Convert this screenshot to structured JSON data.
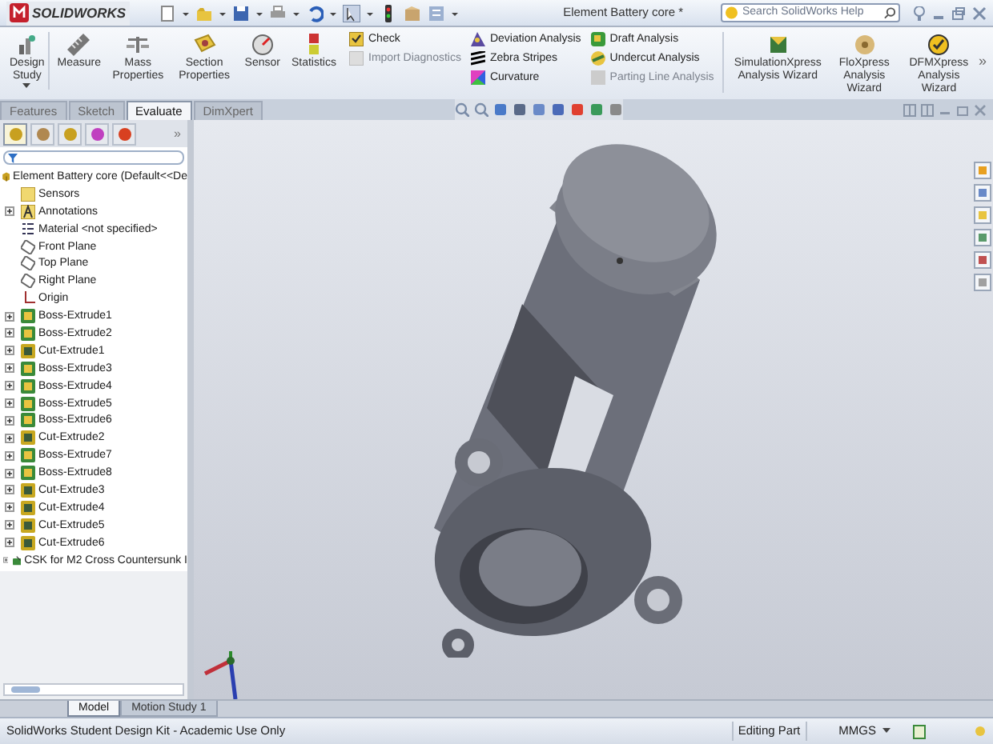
{
  "app": {
    "logo": "SOLIDWORKS"
  },
  "window": {
    "title": "Element Battery core *"
  },
  "search": {
    "placeholder": "Search SolidWorks Help"
  },
  "ribbon": [
    {
      "kind": "large",
      "label": "Design Study",
      "dropdown": true
    },
    {
      "kind": "large",
      "label": "Measure",
      "dropdown": false
    },
    {
      "kind": "large",
      "label": "Mass Properties",
      "dropdown": false
    },
    {
      "kind": "large",
      "label": "Section Properties",
      "dropdown": false
    },
    {
      "kind": "large",
      "label": "Sensor",
      "dropdown": false
    },
    {
      "kind": "large",
      "label": "Statistics",
      "dropdown": false
    },
    {
      "kind": "stack",
      "items": [
        {
          "label": "Check",
          "disabled": false
        },
        {
          "label": "Import Diagnostics",
          "disabled": true
        }
      ]
    },
    {
      "kind": "stack",
      "items": [
        {
          "label": "Deviation Analysis",
          "disabled": false
        },
        {
          "label": "Zebra Stripes",
          "disabled": false
        },
        {
          "label": "Curvature",
          "disabled": false
        }
      ]
    },
    {
      "kind": "stack",
      "items": [
        {
          "label": "Draft Analysis",
          "disabled": false
        },
        {
          "label": "Undercut Analysis",
          "disabled": false
        },
        {
          "label": "Parting Line Analysis",
          "disabled": true
        }
      ]
    },
    {
      "kind": "separator"
    },
    {
      "kind": "large",
      "label": "SimulationXpress Analysis Wizard",
      "dropdown": false
    },
    {
      "kind": "large",
      "label": "FloXpress Analysis Wizard",
      "dropdown": false
    },
    {
      "kind": "large",
      "label": "DFMXpress Analysis Wizard",
      "dropdown": false
    }
  ],
  "ribbon_more": "»",
  "tabs": [
    {
      "label": "Features",
      "selected": false
    },
    {
      "label": "Sketch",
      "selected": false
    },
    {
      "label": "Evaluate",
      "selected": true
    },
    {
      "label": "DimXpert",
      "selected": false
    }
  ],
  "panel_tabs": [
    {
      "selected": true
    },
    {
      "selected": false
    },
    {
      "selected": false
    },
    {
      "selected": false
    },
    {
      "selected": false
    }
  ],
  "panel_more": "»",
  "tree": {
    "label": "Element Battery core  (Default<<De",
    "children": [
      {
        "kind": "sensor",
        "label": "Sensors",
        "expandable": false
      },
      {
        "kind": "annotation",
        "label": "Annotations",
        "expandable": true
      },
      {
        "kind": "material",
        "label": "Material <not specified>",
        "expandable": false
      },
      {
        "kind": "plane",
        "label": "Front Plane",
        "expandable": false
      },
      {
        "kind": "plane",
        "label": "Top Plane",
        "expandable": false
      },
      {
        "kind": "plane",
        "label": "Right Plane",
        "expandable": false
      },
      {
        "kind": "origin",
        "label": "Origin",
        "expandable": false
      },
      {
        "kind": "boss",
        "label": "Boss-Extrude1",
        "expandable": true
      },
      {
        "kind": "boss",
        "label": "Boss-Extrude2",
        "expandable": true
      },
      {
        "kind": "cut",
        "label": "Cut-Extrude1",
        "expandable": true
      },
      {
        "kind": "boss",
        "label": "Boss-Extrude3",
        "expandable": true
      },
      {
        "kind": "boss",
        "label": "Boss-Extrude4",
        "expandable": true
      },
      {
        "kind": "boss",
        "label": "Boss-Extrude5",
        "expandable": true
      },
      {
        "kind": "boss",
        "label": "Boss-Extrude6",
        "expandable": true
      },
      {
        "kind": "cut",
        "label": "Cut-Extrude2",
        "expandable": true
      },
      {
        "kind": "boss",
        "label": "Boss-Extrude7",
        "expandable": true
      },
      {
        "kind": "boss",
        "label": "Boss-Extrude8",
        "expandable": true
      },
      {
        "kind": "cut",
        "label": "Cut-Extrude3",
        "expandable": true
      },
      {
        "kind": "cut",
        "label": "Cut-Extrude4",
        "expandable": true
      },
      {
        "kind": "cut",
        "label": "Cut-Extrude5",
        "expandable": true
      },
      {
        "kind": "cut",
        "label": "Cut-Extrude6",
        "expandable": true
      },
      {
        "kind": "hole",
        "label": "CSK for M2 Cross Countersunk I",
        "expandable": true
      }
    ]
  },
  "bottom_tabs": [
    {
      "label": "Model",
      "selected": true
    },
    {
      "label": "Motion Study 1",
      "selected": false
    }
  ],
  "status_bar": {
    "message": "SolidWorks Student Design Kit - Academic Use Only",
    "mode": "Editing Part",
    "units": "MMGS"
  }
}
